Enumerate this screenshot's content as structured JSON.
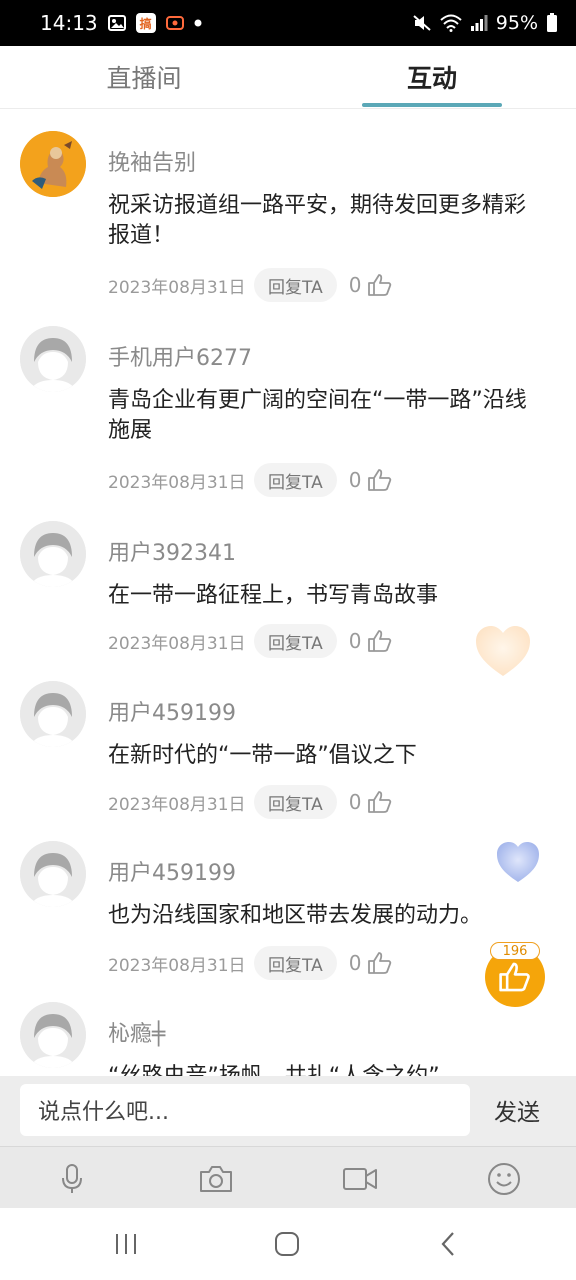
{
  "status_bar": {
    "time": "14:13",
    "app_badge_text": "搞",
    "battery": "95%"
  },
  "tabs": [
    {
      "label": "直播间",
      "active": false
    },
    {
      "label": "互动",
      "active": true
    }
  ],
  "accent_color": "#5ba8b7",
  "comments": [
    {
      "name": "挽袖告别",
      "text": "祝采访报道组一路平安，期待发回更多精彩报道！",
      "date": "2023年08月31日",
      "reply": "回复TA",
      "likes": "0",
      "avatar": "custom"
    },
    {
      "name": "手机用户6277",
      "text": "青岛企业有更广阔的空间在“一带一路”沿线施展",
      "date": "2023年08月31日",
      "reply": "回复TA",
      "likes": "0",
      "avatar": "default"
    },
    {
      "name": "用户392341",
      "text": "在一带一路征程上，书写青岛故事",
      "date": "2023年08月31日",
      "reply": "回复TA",
      "likes": "0",
      "avatar": "default"
    },
    {
      "name": "用户459199",
      "text": "在新时代的“一带一路”倡议之下",
      "date": "2023年08月31日",
      "reply": "回复TA",
      "likes": "0",
      "avatar": "default"
    },
    {
      "name": "用户459199",
      "text": "也为沿线国家和地区带去发展的动力。",
      "date": "2023年08月31日",
      "reply": "回复TA",
      "likes": "0",
      "avatar": "default"
    },
    {
      "name": "杺瘾╪",
      "text": "“丝路虫音”扬帆，共扎“人含之约”",
      "date": "",
      "reply": "",
      "likes": "",
      "avatar": "default"
    }
  ],
  "like_fab": {
    "count": "196"
  },
  "input_bar": {
    "placeholder": "说点什么吧...",
    "send_label": "发送"
  },
  "toolbar_icons": [
    "microphone-icon",
    "camera-icon",
    "video-icon",
    "emoji-icon"
  ]
}
